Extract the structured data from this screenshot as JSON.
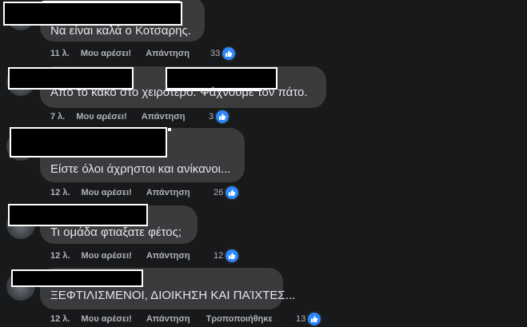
{
  "colors": {
    "background": "#18191a",
    "bubble": "#3a3b3c",
    "text": "#e4e6eb",
    "meta": "#b0b3b8",
    "like_blue": "#2d88ff"
  },
  "comments": [
    {
      "author_redacted": true,
      "text": "Να είναι καλά ο Κοτσαρης.",
      "time": "11 λ.",
      "like_label": "Μου αρέσει!",
      "reply_label": "Απάντηση",
      "reaction_count": "33",
      "reaction_icon": "thumbs-up-icon"
    },
    {
      "author_redacted": true,
      "text": "Από το κακό στο χειρότερο. Ψάχνουμε τον πάτο.",
      "time": "7 λ.",
      "like_label": "Μου αρέσει!",
      "reply_label": "Απάντηση",
      "reaction_count": "3",
      "reaction_icon": "thumbs-up-icon"
    },
    {
      "author_redacted": true,
      "text": "Είστε όλοι άχρηστοι και ανίκανοι...",
      "time": "12 λ.",
      "like_label": "Μου αρέσει!",
      "reply_label": "Απάντηση",
      "reaction_count": "26",
      "reaction_icon": "thumbs-up-icon"
    },
    {
      "author_redacted": true,
      "text": "Τι ομάδα φτιαξατε φέτος;",
      "time": "12 λ.",
      "like_label": "Μου αρέσει!",
      "reply_label": "Απάντηση",
      "reaction_count": "12",
      "reaction_icon": "thumbs-up-icon"
    },
    {
      "author_redacted": true,
      "text": "ΞΕΦΤΙΛΙΣΜΕΝΟΙ, ΔΙΟΙΚΗΣΗ ΚΑΙ ΠΑΊΧΤΕΣ...",
      "time": "12 λ.",
      "like_label": "Μου αρέσει!",
      "reply_label": "Απάντηση",
      "edited_label": "Τροποποιήθηκε",
      "reaction_count": "13",
      "reaction_icon": "thumbs-up-icon"
    }
  ]
}
